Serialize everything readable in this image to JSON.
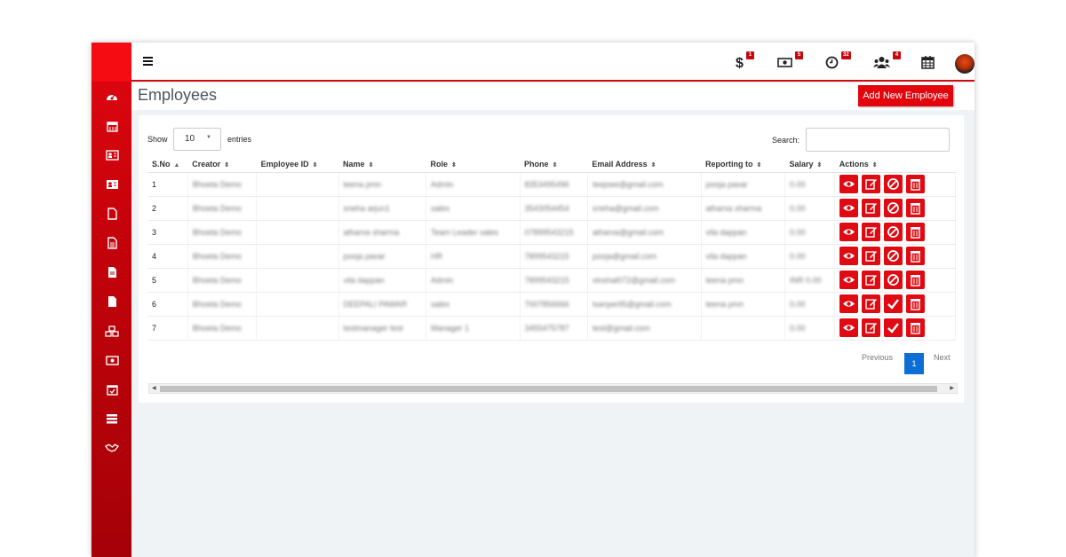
{
  "header": {
    "badges": [
      "1",
      "5",
      "32",
      "4"
    ],
    "icons": [
      "dollar-icon",
      "money-icon",
      "clock-icon",
      "users-icon",
      "calendar-icon"
    ]
  },
  "page": {
    "title": "Employees",
    "add_button": "Add New Employee"
  },
  "table_controls": {
    "show_label": "Show",
    "entries_value": "10",
    "entries_label": "entries",
    "search_label": "Search:"
  },
  "table": {
    "headers": [
      "S.No",
      "Creator",
      "Employee ID",
      "Name",
      "Role",
      "Phone",
      "Email Address",
      "Reporting to",
      "Salary",
      "Actions"
    ],
    "rows": [
      {
        "sno": "1",
        "creator": "Bhoeta Demo",
        "employee_id": "",
        "name": "teena pmn",
        "role": "Admin",
        "phone": "8353495496",
        "email": "teejoee@gmail.com",
        "reporting_to": "pooja pavar",
        "salary": "0.00",
        "approved": false
      },
      {
        "sno": "2",
        "creator": "Bhoeta Demo",
        "employee_id": "",
        "name": "sneha arjun1",
        "role": "sales",
        "phone": "3543054454",
        "email": "sneha@gmail.com",
        "reporting_to": "atharva sharma",
        "salary": "0.00",
        "approved": false
      },
      {
        "sno": "3",
        "creator": "Bhoeta Demo",
        "employee_id": "",
        "name": "atharva sharma",
        "role": "Team Leader sales",
        "phone": "07899543215",
        "email": "atharva@gmail.com",
        "reporting_to": "vila dappan",
        "salary": "0.00",
        "approved": false
      },
      {
        "sno": "4",
        "creator": "Bhoeta Demo",
        "employee_id": "",
        "name": "pooja pavar",
        "role": "HR",
        "phone": "7899543215",
        "email": "pooja@gmail.com",
        "reporting_to": "vila dappan",
        "salary": "0.00",
        "approved": false
      },
      {
        "sno": "5",
        "creator": "Bhoeta Demo",
        "employee_id": "",
        "name": "vila dappan",
        "role": "Admin",
        "phone": "7899543215",
        "email": "vinshal072@gmail.com",
        "reporting_to": "teena pmn",
        "salary": "INR 0.00",
        "approved": false
      },
      {
        "sno": "6",
        "creator": "Bhoeta Demo",
        "employee_id": "",
        "name": "DEEPALI PAWAR",
        "role": "sales",
        "phone": "7007856666",
        "email": "lsanperli5@gmail.com",
        "reporting_to": "teena pmn",
        "salary": "0.00",
        "approved": true
      },
      {
        "sno": "7",
        "creator": "Bhoeta Demo",
        "employee_id": "",
        "name": "testmanager test",
        "role": "Manager 1",
        "phone": "3455475787",
        "email": "test@gmail.com",
        "reporting_to": "",
        "salary": "0.00",
        "approved": true
      }
    ]
  },
  "pagination": {
    "previous": "Previous",
    "current": "1",
    "next": "Next"
  },
  "colors": {
    "accent": "#e3050d",
    "sidebar": "#c3020a",
    "page_active": "#0d6fd6"
  }
}
